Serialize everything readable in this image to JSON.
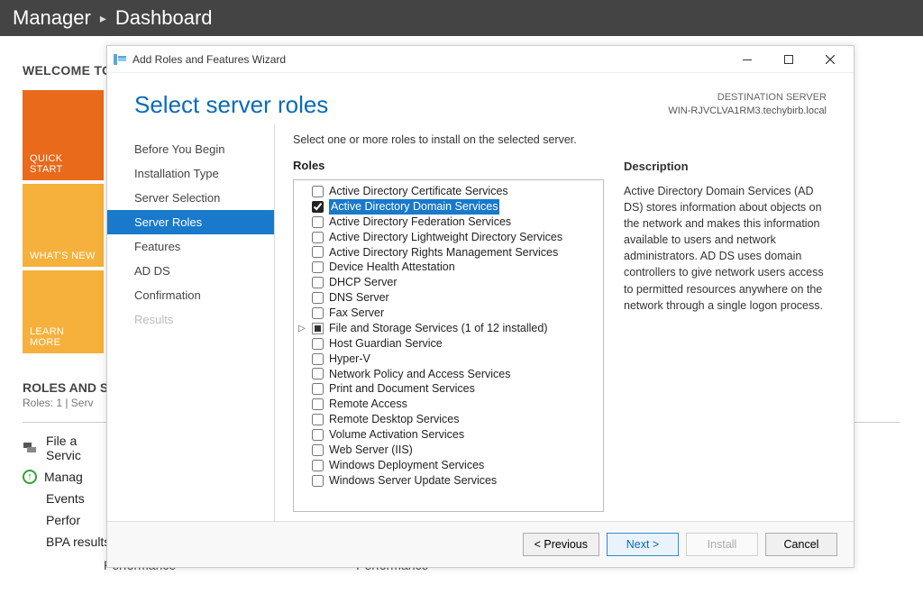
{
  "serverManager": {
    "breadcrumb": [
      "Manager",
      "Dashboard"
    ],
    "welcome": "WELCOME TO",
    "tiles": {
      "quick": "QUICK START",
      "whatsNew": "WHAT'S NEW",
      "learn": "LEARN MORE"
    },
    "rolesHeader": "ROLES AND S",
    "rolesSub": "Roles: 1  |  Serv",
    "cards": {
      "file": "File a\nServic",
      "manage": "Manag",
      "events": "Events",
      "perf": "Perfor",
      "bpa": "BPA results"
    },
    "perfLabel": "Performance"
  },
  "wizard": {
    "windowTitle": "Add Roles and Features Wizard",
    "destLabel": "DESTINATION SERVER",
    "destServer": "WIN-RJVCLVA1RM3.techybirb.local",
    "heading": "Select server roles",
    "nav": [
      {
        "label": "Before You Begin",
        "selected": false,
        "disabled": false
      },
      {
        "label": "Installation Type",
        "selected": false,
        "disabled": false
      },
      {
        "label": "Server Selection",
        "selected": false,
        "disabled": false
      },
      {
        "label": "Server Roles",
        "selected": true,
        "disabled": false
      },
      {
        "label": "Features",
        "selected": false,
        "disabled": false
      },
      {
        "label": "AD DS",
        "selected": false,
        "disabled": false
      },
      {
        "label": "Confirmation",
        "selected": false,
        "disabled": false
      },
      {
        "label": "Results",
        "selected": false,
        "disabled": true
      }
    ],
    "instruction": "Select one or more roles to install on the selected server.",
    "rolesHeading": "Roles",
    "roles": [
      {
        "label": "Active Directory Certificate Services",
        "checked": false
      },
      {
        "label": "Active Directory Domain Services",
        "checked": true,
        "selected": true
      },
      {
        "label": "Active Directory Federation Services",
        "checked": false
      },
      {
        "label": "Active Directory Lightweight Directory Services",
        "checked": false
      },
      {
        "label": "Active Directory Rights Management Services",
        "checked": false
      },
      {
        "label": "Device Health Attestation",
        "checked": false
      },
      {
        "label": "DHCP Server",
        "checked": false
      },
      {
        "label": "DNS Server",
        "checked": false
      },
      {
        "label": "Fax Server",
        "checked": false
      },
      {
        "label": "File and Storage Services (1 of 12 installed)",
        "checked": false,
        "partial": true,
        "expandable": true
      },
      {
        "label": "Host Guardian Service",
        "checked": false
      },
      {
        "label": "Hyper-V",
        "checked": false
      },
      {
        "label": "Network Policy and Access Services",
        "checked": false
      },
      {
        "label": "Print and Document Services",
        "checked": false
      },
      {
        "label": "Remote Access",
        "checked": false
      },
      {
        "label": "Remote Desktop Services",
        "checked": false
      },
      {
        "label": "Volume Activation Services",
        "checked": false
      },
      {
        "label": "Web Server (IIS)",
        "checked": false
      },
      {
        "label": "Windows Deployment Services",
        "checked": false
      },
      {
        "label": "Windows Server Update Services",
        "checked": false
      }
    ],
    "descHeading": "Description",
    "descText": "Active Directory Domain Services (AD DS) stores information about objects on the network and makes this information available to users and network administrators. AD DS uses domain controllers to give network users access to permitted resources anywhere on the network through a single logon process.",
    "buttons": {
      "prev": "< Previous",
      "next": "Next >",
      "install": "Install",
      "cancel": "Cancel"
    }
  }
}
